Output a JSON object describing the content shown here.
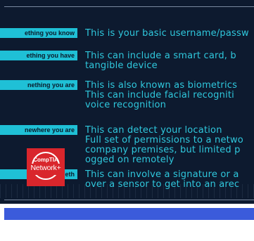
{
  "rows": [
    {
      "label": "ething you know",
      "lines": [
        "This is your basic username/passw"
      ]
    },
    {
      "label": "ething you have",
      "lines": [
        "This can include a smart card, b",
        "tangible device"
      ]
    },
    {
      "label": "nething you are",
      "lines": [
        "This is also known as biometrics",
        "This can include facial recogniti",
        "voice recognition"
      ]
    },
    {
      "label": "newhere you are",
      "lines": [
        "This can detect your location",
        "Full set of permissions to a netwo",
        "company premises, but limited p",
        "ogged on remotely"
      ]
    },
    {
      "label": "meth",
      "lines": [
        "This can involve a signature or a",
        "over a sensor to get into an arec"
      ]
    }
  ],
  "logo": {
    "brand": "CompTIA",
    "cert": "Network+"
  },
  "colors": {
    "background": "#0d1a2f",
    "label_bg": "#1fc0d6",
    "text": "#2fc8dd",
    "logo": "#d9262c",
    "bar": "#3b5bdb"
  }
}
